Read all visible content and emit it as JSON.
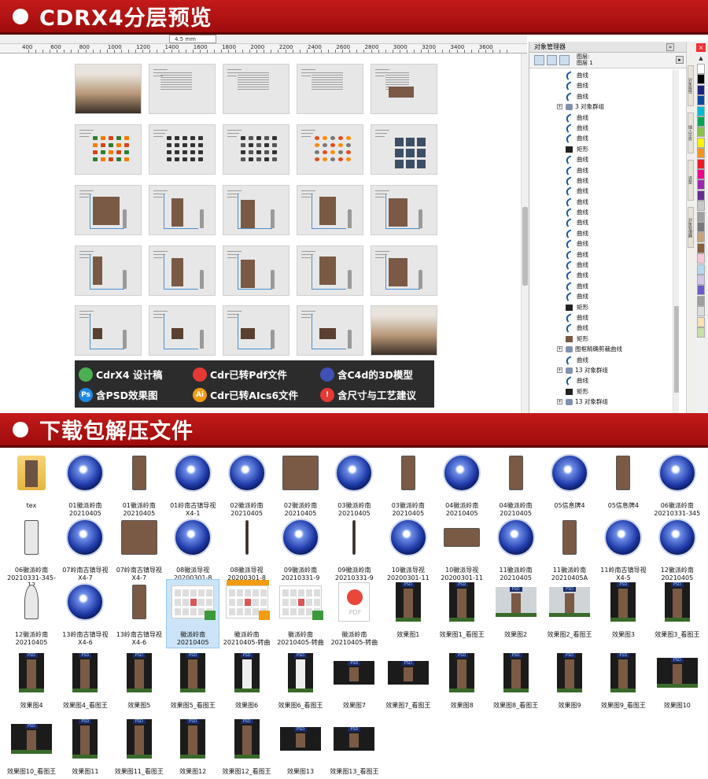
{
  "banners": {
    "preview_title": "CDRX4分层预览",
    "download_title": "下载包解压文件"
  },
  "toolbar": {
    "zoom_value": "4.5 mm"
  },
  "ruler_ticks": [
    "400",
    "600",
    "800",
    "1000",
    "1200",
    "1400",
    "1600",
    "1800",
    "2000",
    "2200",
    "2400",
    "2600",
    "2800",
    "3000",
    "3200",
    "3400",
    "3600"
  ],
  "features": [
    {
      "icon": "cdr-icon",
      "label": "CdrX4 设计稿",
      "color": "#4caf50"
    },
    {
      "icon": "pdf-icon",
      "label": "Cdr已转Pdf文件",
      "color": "#e53935"
    },
    {
      "icon": "c4d-icon",
      "label": "含C4d的3D模型",
      "color": "#3f51b5"
    },
    {
      "icon": "ps-icon",
      "label": "含PSD效果图",
      "color": "#1e88e5",
      "text": "Ps"
    },
    {
      "icon": "ai-icon",
      "label": "Cdr已转AIcs6文件",
      "color": "#f39c12",
      "text": "Ai"
    },
    {
      "icon": "warning-icon",
      "label": "含尺寸与工艺建议",
      "color": "#e53935",
      "text": "!"
    }
  ],
  "object_manager": {
    "title": "对象管理器",
    "layer_label_1": "图层:",
    "layer_label_2": "图层 1",
    "rows": [
      {
        "type": "curve",
        "label": "曲线"
      },
      {
        "type": "curve",
        "label": "曲线"
      },
      {
        "type": "curve",
        "label": "曲线"
      },
      {
        "type": "group",
        "label": "3 对象群组"
      },
      {
        "type": "curve",
        "label": "曲线"
      },
      {
        "type": "curve",
        "label": "曲线"
      },
      {
        "type": "curve",
        "label": "曲线"
      },
      {
        "type": "rect",
        "label": "矩形"
      },
      {
        "type": "curve",
        "label": "曲线"
      },
      {
        "type": "curve",
        "label": "曲线"
      },
      {
        "type": "curve",
        "label": "曲线"
      },
      {
        "type": "curve",
        "label": "曲线"
      },
      {
        "type": "curve",
        "label": "曲线"
      },
      {
        "type": "curve",
        "label": "曲线"
      },
      {
        "type": "curve",
        "label": "曲线"
      },
      {
        "type": "curve",
        "label": "曲线"
      },
      {
        "type": "curve",
        "label": "曲线"
      },
      {
        "type": "curve",
        "label": "曲线"
      },
      {
        "type": "curve",
        "label": "曲线"
      },
      {
        "type": "curve",
        "label": "曲线"
      },
      {
        "type": "curve",
        "label": "曲线"
      },
      {
        "type": "curve",
        "label": "曲线"
      },
      {
        "type": "rect",
        "label": "矩形"
      },
      {
        "type": "curve",
        "label": "曲线"
      },
      {
        "type": "curve",
        "label": "曲线"
      },
      {
        "type": "rect",
        "label": "矩形"
      },
      {
        "type": "group",
        "label": "图框精确剪裁曲线"
      },
      {
        "type": "curve",
        "label": "曲线"
      },
      {
        "type": "group",
        "label": "13 对象群组"
      },
      {
        "type": "curve",
        "label": "曲线"
      },
      {
        "type": "rect",
        "label": "矩形"
      },
      {
        "type": "group",
        "label": "13 对象群组"
      }
    ]
  },
  "vertical_tabs": [
    "对象属性",
    "插入字符",
    "造型",
    "对象管理器"
  ],
  "palette": [
    "#ffffff",
    "#000000",
    "#1a237e",
    "#0d47a1",
    "#00bcd4",
    "#00a651",
    "#8bc34a",
    "#fff200",
    "#f7941d",
    "#ed1c24",
    "#ec008c",
    "#9c27b0",
    "#662d91",
    "#c8c8c8",
    "#a0a0a0",
    "#787878",
    "#c7a27c",
    "#8b5e3c",
    "#f7c6d9",
    "#b3d9f2",
    "#d1c4e9",
    "#6a5acd",
    "#9e9e9e",
    "#dcdcdc",
    "#ffe0b2",
    "#c5e1a5"
  ],
  "files": [
    {
      "kind": "folder",
      "label": "tex"
    },
    {
      "kind": "c4d",
      "label": "01徽派岭南\n20210405"
    },
    {
      "kind": "sign-gate",
      "label": "01徽派岭南\n20210405"
    },
    {
      "kind": "c4d",
      "label": "01岭南古镇导视\nX4-1"
    },
    {
      "kind": "c4d",
      "label": "02徽派岭南\n20210405"
    },
    {
      "kind": "sign-board",
      "label": "02徽派岭南\n20210405"
    },
    {
      "kind": "c4d",
      "label": "03徽派岭南\n20210405"
    },
    {
      "kind": "sign-post",
      "label": "03徽派岭南\n20210405"
    },
    {
      "kind": "c4d",
      "label": "04徽派岭南\n20210405"
    },
    {
      "kind": "sign-post",
      "label": "04徽派岭南\n20210405"
    },
    {
      "kind": "c4d",
      "label": "05信息牌4"
    },
    {
      "kind": "sign-post",
      "label": "05信息牌4"
    },
    {
      "kind": "c4d",
      "label": "06徽派岭南\n20210331-345"
    },
    {
      "kind": "sign-number",
      "label": "06徽派岭南\n20210331-345-\n12"
    },
    {
      "kind": "c4d",
      "label": "07岭南古镇导视\nX4-7"
    },
    {
      "kind": "sign-board",
      "label": "07岭南古镇导视\nX4-7"
    },
    {
      "kind": "c4d",
      "label": "08徽派导视\n20200301-8"
    },
    {
      "kind": "sign-lamp",
      "label": "08徽派导视\n20200301-8"
    },
    {
      "kind": "c4d",
      "label": "09徽派岭南\n20210331-9"
    },
    {
      "kind": "sign-lamp",
      "label": "09徽派岭南\n20210331-9"
    },
    {
      "kind": "c4d",
      "label": "10徽派导视\n20200301-11"
    },
    {
      "kind": "sign-bench",
      "label": "10徽派导视\n20200301-11"
    },
    {
      "kind": "c4d",
      "label": "11徽派岭南\n20210405"
    },
    {
      "kind": "sign-post",
      "label": "11徽派岭南\n20210405A"
    },
    {
      "kind": "c4d",
      "label": "11岭南古镇导视\nX4-5"
    },
    {
      "kind": "c4d",
      "label": "12徽派岭南\n20210405"
    },
    {
      "kind": "sign-round",
      "label": "12徽派岭南\n20210405"
    },
    {
      "kind": "c4d",
      "label": "13岭南古镇导视\nX4-6"
    },
    {
      "kind": "sign-gate",
      "label": "13岭南古镇导视\nX4-6"
    },
    {
      "kind": "cdr",
      "label": "徽派岭南\n20210405",
      "selected": true
    },
    {
      "kind": "ai",
      "label": "徽派岭南\n20210405-转曲"
    },
    {
      "kind": "cdr",
      "label": "徽派岭南\n20210405-转曲"
    },
    {
      "kind": "pdf",
      "label": "徽派岭南\n20210405-转曲"
    },
    {
      "kind": "photo",
      "label": "效果图1"
    },
    {
      "kind": "photo",
      "label": "效果图1_看图王"
    },
    {
      "kind": "photo-light",
      "label": "效果图2"
    },
    {
      "kind": "photo-light",
      "label": "效果图2_看图王"
    },
    {
      "kind": "photo",
      "label": "效果图3"
    },
    {
      "kind": "photo",
      "label": "效果图3_看图王"
    },
    {
      "kind": "photo",
      "label": "效果图4"
    },
    {
      "kind": "photo",
      "label": "效果图4_看图王"
    },
    {
      "kind": "photo",
      "label": "效果图5"
    },
    {
      "kind": "photo",
      "label": "效果图5_看图王"
    },
    {
      "kind": "photo-number",
      "label": "效果图6"
    },
    {
      "kind": "photo-number",
      "label": "效果图6_看图王"
    },
    {
      "kind": "photo-wide",
      "label": "效果图7"
    },
    {
      "kind": "photo-wide",
      "label": "效果图7_看图王"
    },
    {
      "kind": "photo",
      "label": "效果图8"
    },
    {
      "kind": "photo",
      "label": "效果图8_看图王"
    },
    {
      "kind": "photo",
      "label": "效果图9"
    },
    {
      "kind": "photo",
      "label": "效果图9_看图王"
    },
    {
      "kind": "photo-bench",
      "label": "效果图10"
    },
    {
      "kind": "photo-bench",
      "label": "效果图10_看图王"
    },
    {
      "kind": "photo",
      "label": "效果图11"
    },
    {
      "kind": "photo",
      "label": "效果图11_看图王"
    },
    {
      "kind": "photo",
      "label": "效果图12"
    },
    {
      "kind": "photo",
      "label": "效果图12_看图王"
    },
    {
      "kind": "photo-wide",
      "label": "效果图13"
    },
    {
      "kind": "photo-wide",
      "label": "效果图13_看图王"
    }
  ]
}
